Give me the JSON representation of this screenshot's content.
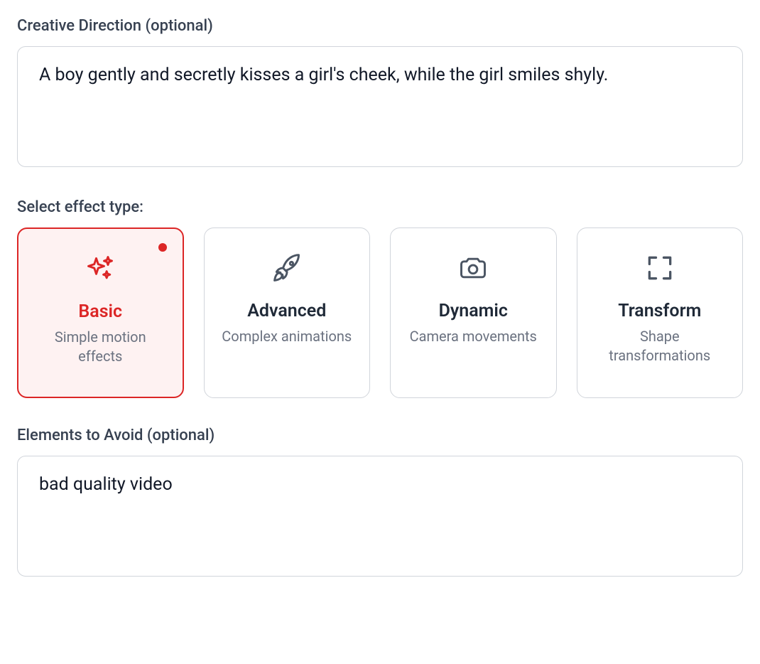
{
  "creative_direction": {
    "label": "Creative Direction (optional)",
    "value": "A boy gently and secretly kisses a girl's cheek, while the girl smiles shyly."
  },
  "effect_type": {
    "label": "Select effect type:",
    "options": [
      {
        "id": "basic",
        "title": "Basic",
        "subtitle": "Simple motion effects",
        "icon": "sparkles-icon",
        "selected": true
      },
      {
        "id": "advanced",
        "title": "Advanced",
        "subtitle": "Complex animations",
        "icon": "rocket-icon",
        "selected": false
      },
      {
        "id": "dynamic",
        "title": "Dynamic",
        "subtitle": "Camera movements",
        "icon": "camera-icon",
        "selected": false
      },
      {
        "id": "transform",
        "title": "Transform",
        "subtitle": "Shape transformations",
        "icon": "expand-icon",
        "selected": false
      }
    ]
  },
  "elements_to_avoid": {
    "label": "Elements to Avoid (optional)",
    "value": "bad quality video"
  }
}
